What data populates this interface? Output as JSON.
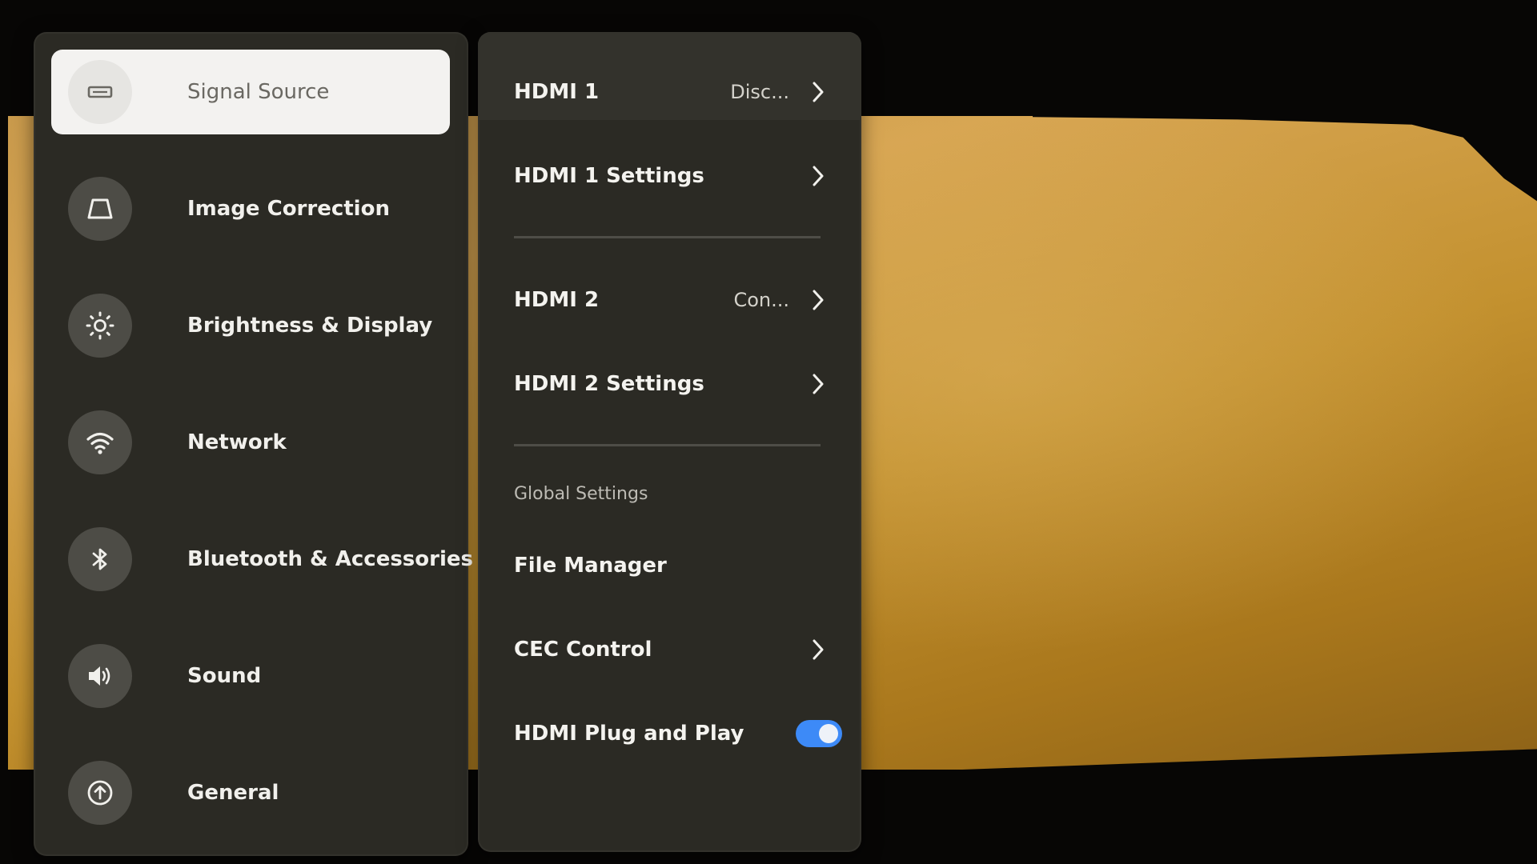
{
  "sidebar": {
    "items": [
      {
        "label": "Signal Source",
        "icon": "hdmi-port-icon",
        "selected": true
      },
      {
        "label": "Image Correction",
        "icon": "trapezoid-keystone-icon",
        "selected": false
      },
      {
        "label": "Brightness & Display",
        "icon": "sun-brightness-icon",
        "selected": false
      },
      {
        "label": "Network",
        "icon": "wifi-icon",
        "selected": false
      },
      {
        "label": "Bluetooth & Accessories",
        "icon": "bluetooth-icon",
        "selected": false
      },
      {
        "label": "Sound",
        "icon": "speaker-icon",
        "selected": false
      },
      {
        "label": "General",
        "icon": "arrow-up-circle-icon",
        "selected": false
      }
    ]
  },
  "signal_panel": {
    "hdmi1": {
      "label": "HDMI 1",
      "status": "Disc..."
    },
    "hdmi1_settings": {
      "label": "HDMI 1 Settings"
    },
    "hdmi2": {
      "label": "HDMI 2",
      "status": "Con..."
    },
    "hdmi2_settings": {
      "label": "HDMI 2 Settings"
    },
    "global_section_title": "Global Settings",
    "file_manager": {
      "label": "File Manager"
    },
    "cec_control": {
      "label": "CEC Control"
    },
    "plug_and_play": {
      "label": "HDMI Plug and Play",
      "enabled": true
    }
  },
  "colors": {
    "panel_bg": "#2b2a24",
    "selected_bg": "#f3f2f0",
    "toggle_on": "#3d8af7",
    "icon_circle": "#4d4c46"
  }
}
